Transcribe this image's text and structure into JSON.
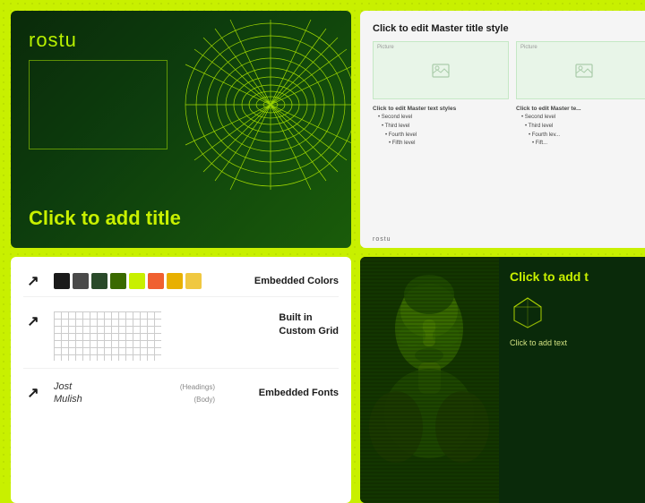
{
  "bg_color": "#c8f000",
  "slides": {
    "main": {
      "logo": "rostu",
      "title": "Click to add title",
      "bg": "dark-green"
    },
    "template": {
      "master_title": "Click to edit Master title style",
      "picture_label": "Picture",
      "text_prompt": "Click to edit Master text styles",
      "levels": [
        "Second level",
        "Third level",
        "Fourth level",
        "Fifth level"
      ],
      "footer": "rostu"
    },
    "statue": {
      "title": "Click to add t",
      "subtext": "Click to add text"
    }
  },
  "info": {
    "colors_label": "Embedded Colors",
    "swatches": [
      "#1a1a1a",
      "#4a4a4a",
      "#2a4a2a",
      "#3a6a00",
      "#c8f000",
      "#f06030",
      "#e8b000",
      "#f0c840"
    ],
    "grid_label_line1": "Built in",
    "grid_label_line2": "Custom Grid",
    "fonts_label": "Embedded Fonts",
    "font1_name": "Jost",
    "font1_role": "(Headings)",
    "font2_name": "Mulish",
    "font2_role": "(Body)"
  },
  "icons": {
    "arrow": "↗",
    "picture": "🖼",
    "diamond": "◇"
  }
}
